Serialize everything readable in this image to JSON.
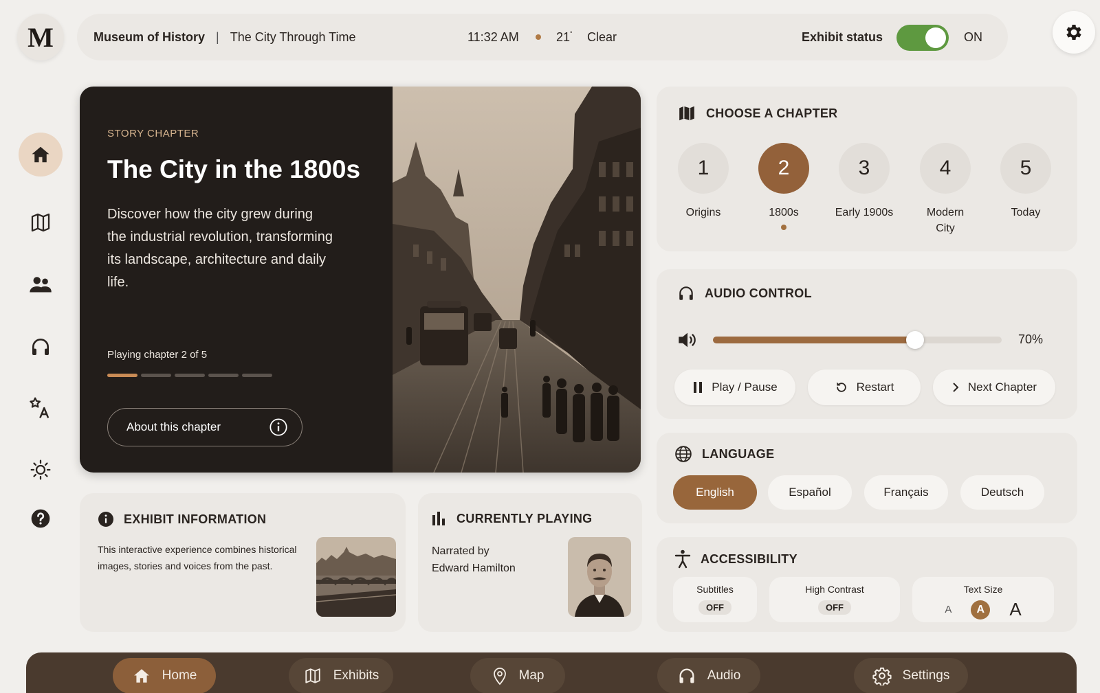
{
  "logo": {
    "letter": "M"
  },
  "header": {
    "museum": "Museum of History",
    "separator": "|",
    "subtitle": "The City Through Time",
    "time": "11:32 AM",
    "temperature": "21",
    "degree": "°",
    "weather": "Clear",
    "exhibit_status_label": "Exhibit status",
    "exhibit_status_value": "ON"
  },
  "hero": {
    "label": "STORY CHAPTER",
    "title": "The City in the 1800s",
    "description": "Discover how the city grew during the industrial revolution, transforming its landscape, architecture and daily life.",
    "playing": "Playing chapter 2 of 5",
    "progress": {
      "current": 2,
      "total": 5
    },
    "about_button": "About this chapter"
  },
  "chapters": {
    "heading": "CHOOSE A CHAPTER",
    "items": [
      {
        "number": "1",
        "label": "Origins"
      },
      {
        "number": "2",
        "label": "1800s"
      },
      {
        "number": "3",
        "label": "Early 1900s"
      },
      {
        "number": "4",
        "label": "Modern City"
      },
      {
        "number": "5",
        "label": "Today"
      }
    ],
    "active_index": 1
  },
  "audio": {
    "heading": "AUDIO CONTROL",
    "volume": 70,
    "volume_label": "70%",
    "buttons": {
      "play_pause": "Play / Pause",
      "restart": "Restart",
      "next": "Next Chapter"
    }
  },
  "language": {
    "heading": "LANGUAGE",
    "options": [
      "English",
      "Español",
      "Français",
      "Deutsch"
    ],
    "selected": "English"
  },
  "accessibility": {
    "heading": "ACCESSIBILITY",
    "subtitles": {
      "label": "Subtitles",
      "value": "OFF"
    },
    "high_contrast": {
      "label": "High Contrast",
      "value": "OFF"
    },
    "text_size": {
      "label": "Text Size",
      "small": "A",
      "medium": "A",
      "large": "A",
      "selected": "medium"
    }
  },
  "exhibit_info": {
    "heading": "EXHIBIT INFORMATION",
    "text": "This interactive experience combines historical images, stories and voices from the past."
  },
  "currently_playing": {
    "heading": "CURRENTLY PLAYING",
    "narrated_by": "Narrated by",
    "narrator": "Edward Hamilton"
  },
  "bottom_nav": {
    "items": [
      "Home",
      "Exhibits",
      "Map",
      "Audio",
      "Settings"
    ],
    "active": "Home"
  },
  "colors": {
    "accent": "#93613a",
    "toggle_on": "#5e9940",
    "hero_bg": "#221d1a",
    "nav_bg": "#4a3a2e"
  },
  "icons": {
    "sidebar": [
      "home-icon",
      "map-icon",
      "people-icon",
      "headphones-icon",
      "translate-icon",
      "brightness-icon",
      "help-icon"
    ]
  }
}
